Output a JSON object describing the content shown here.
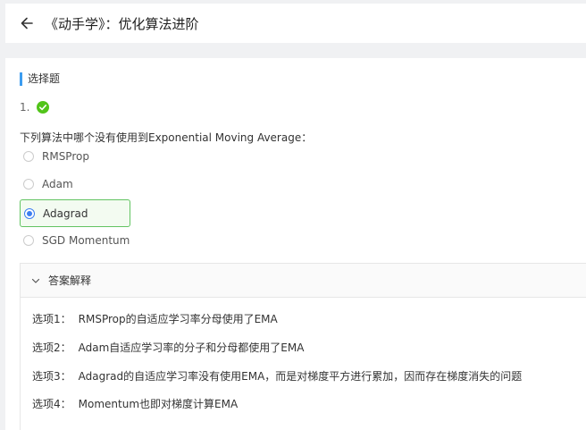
{
  "header": {
    "title": "《动手学》：优化算法进阶"
  },
  "section": {
    "label": "选择题"
  },
  "question": {
    "number": "1.",
    "text": "下列算法中哪个没有使用到Exponential Moving Average：",
    "options": [
      {
        "label": "RMSProp",
        "selected": false
      },
      {
        "label": "Adam",
        "selected": false
      },
      {
        "label": "Adagrad",
        "selected": true
      },
      {
        "label": "SGD Momentum",
        "selected": false
      }
    ]
  },
  "explanation": {
    "title": "答案解释",
    "lines": [
      {
        "label": "选项1：",
        "text": "RMSProp的自适应学习率分母使用了EMA"
      },
      {
        "label": "选项2：",
        "text": "Adam自适应学习率的分子和分母都使用了EMA"
      },
      {
        "label": "选项3：",
        "text": "Adagrad的自适应学习率没有使用EMA，而是对梯度平方进行累加，因而存在梯度消失的问题"
      },
      {
        "label": "选项4：",
        "text": "Momentum也即对梯度计算EMA"
      }
    ]
  },
  "colors": {
    "accent": "#3c9cf0",
    "correct": "#52c41a",
    "selected_border": "#62c462"
  },
  "icons": {
    "back": "arrow-left-icon",
    "correct": "check-circle-icon",
    "collapse": "chevron-down-icon"
  }
}
